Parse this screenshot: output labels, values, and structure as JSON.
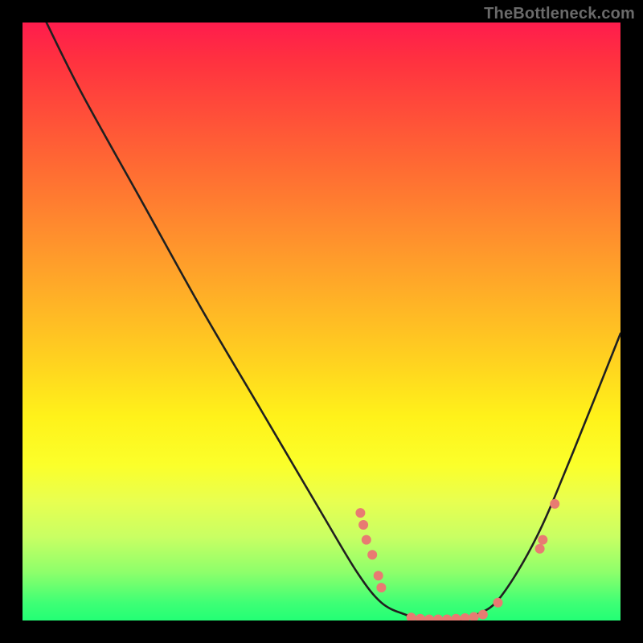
{
  "watermark": "TheBottleneck.com",
  "chart_data": {
    "type": "line",
    "title": "",
    "xlabel": "",
    "ylabel": "",
    "xlim": [
      0,
      100
    ],
    "ylim": [
      0,
      100
    ],
    "series": [
      {
        "name": "bottleneck-curve",
        "x": [
          4,
          10,
          20,
          30,
          40,
          50,
          56,
          60,
          64,
          68,
          72,
          76,
          80,
          86,
          92,
          100
        ],
        "y": [
          100,
          88,
          70,
          52,
          35,
          18,
          8,
          3,
          1,
          0,
          0,
          1,
          4,
          14,
          28,
          48
        ]
      }
    ],
    "markers": [
      {
        "x": 56.5,
        "y": 18.0
      },
      {
        "x": 57.0,
        "y": 16.0
      },
      {
        "x": 57.5,
        "y": 13.5
      },
      {
        "x": 58.5,
        "y": 11.0
      },
      {
        "x": 59.5,
        "y": 7.5
      },
      {
        "x": 60.0,
        "y": 5.5
      },
      {
        "x": 65.0,
        "y": 0.5
      },
      {
        "x": 66.5,
        "y": 0.3
      },
      {
        "x": 68.0,
        "y": 0.2
      },
      {
        "x": 69.5,
        "y": 0.2
      },
      {
        "x": 71.0,
        "y": 0.2
      },
      {
        "x": 72.5,
        "y": 0.3
      },
      {
        "x": 74.0,
        "y": 0.4
      },
      {
        "x": 75.5,
        "y": 0.6
      },
      {
        "x": 77.0,
        "y": 1.0
      },
      {
        "x": 79.5,
        "y": 3.0
      },
      {
        "x": 86.5,
        "y": 12.0
      },
      {
        "x": 87.0,
        "y": 13.5
      },
      {
        "x": 89.0,
        "y": 19.5
      }
    ],
    "marker_radius": 6
  }
}
